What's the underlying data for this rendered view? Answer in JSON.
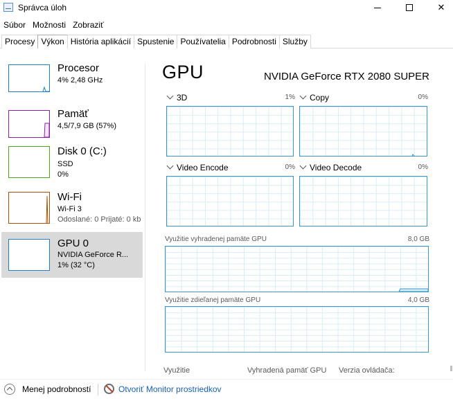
{
  "window": {
    "title": "Správca úloh",
    "minimize_icon": "minimize-icon",
    "maximize_icon": "maximize-icon",
    "close_glyph": "✕"
  },
  "menu": [
    "Súbor",
    "Možnosti",
    "Zobraziť"
  ],
  "tabs": [
    {
      "label": "Procesy",
      "active": false
    },
    {
      "label": "Výkon",
      "active": true
    },
    {
      "label": "História aplikácií",
      "active": false
    },
    {
      "label": "Spustenie",
      "active": false
    },
    {
      "label": "Používatelia",
      "active": false
    },
    {
      "label": "Podrobnosti",
      "active": false
    },
    {
      "label": "Služby",
      "active": false
    }
  ],
  "sidebar": {
    "items": [
      {
        "title": "Procesor",
        "line1": "4%  2,48 GHz",
        "line2": "",
        "color": "#1f7fc0",
        "selected": false
      },
      {
        "title": "Pamäť",
        "line1": "4,5/7,9 GB (57%)",
        "line2": "",
        "color": "#8b1fa9",
        "selected": false
      },
      {
        "title": "Disk 0 (C:)",
        "line1": "SSD",
        "line2": "0%",
        "color": "#4da61b",
        "selected": false
      },
      {
        "title": "Wi-Fi",
        "line1": "Wi-Fi 3",
        "line2": "Odoslané: 0 Prijaté: 0 kb",
        "color": "#a74f01",
        "selected": false
      },
      {
        "title": "GPU 0",
        "line1": "NVIDIA GeForce R...",
        "line2": "1%  (32 °C)",
        "color": "#1f7fc0",
        "selected": true
      }
    ]
  },
  "main": {
    "title": "GPU",
    "gpu_name": "NVIDIA GeForce RTX 2080 SUPER",
    "engines": [
      {
        "name": "3D",
        "value": "1%"
      },
      {
        "name": "Copy",
        "value": "0%"
      },
      {
        "name": "Video Encode",
        "value": "0%"
      },
      {
        "name": "Video Decode",
        "value": "0%"
      }
    ],
    "dedicated_memory": {
      "label": "Využitie vyhradenej pamäte GPU",
      "value": "8,0 GB"
    },
    "shared_memory": {
      "label": "Využitie zdieľanej pamäte GPU",
      "value": "4,0 GB"
    },
    "stats_labels": [
      "Využitie",
      "Vyhradená pamäť GPU",
      "Verzia ovládača:"
    ]
  },
  "footer": {
    "fewer_details": "Menej podrobností",
    "open_monitor": "Otvoriť Monitor prostriedkov"
  }
}
